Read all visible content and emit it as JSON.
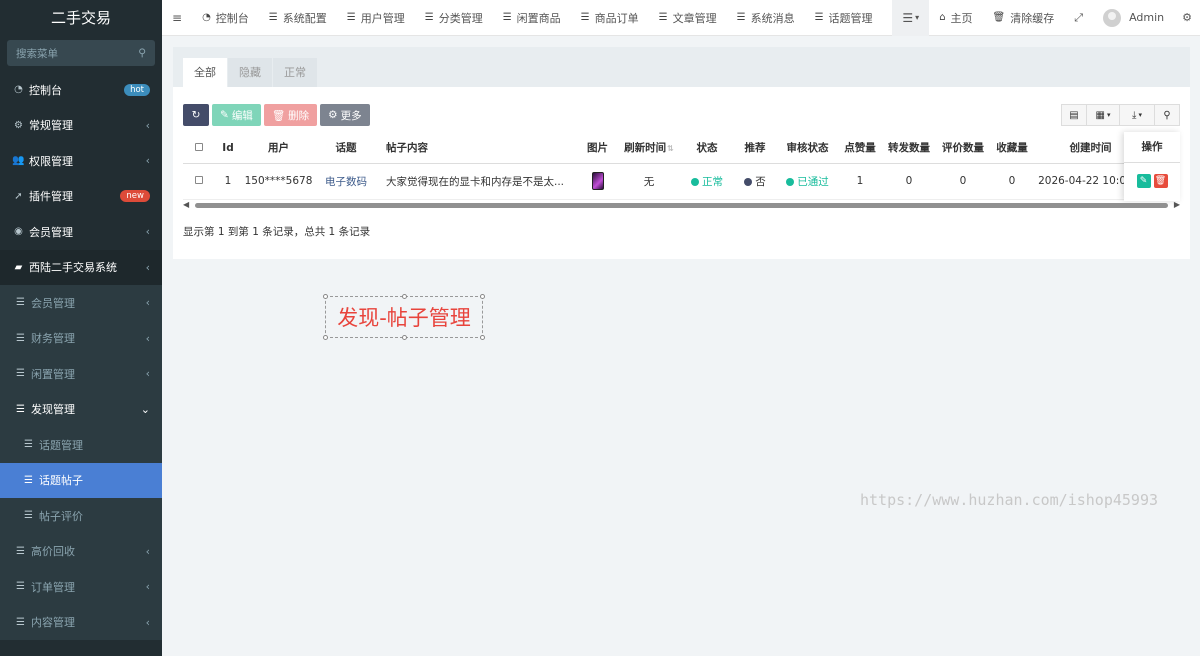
{
  "app": {
    "title": "二手交易"
  },
  "sidebar": {
    "search_placeholder": "搜索菜单",
    "items": [
      {
        "label": "控制台",
        "badge": "hot"
      },
      {
        "label": "常规管理"
      },
      {
        "label": "权限管理"
      },
      {
        "label": "插件管理",
        "badge": "new"
      },
      {
        "label": "会员管理"
      },
      {
        "label": "西陆二手交易系统"
      }
    ],
    "sub_items": [
      {
        "label": "会员管理"
      },
      {
        "label": "财务管理"
      },
      {
        "label": "闲置管理"
      },
      {
        "label": "发现管理"
      },
      {
        "label": "话题管理"
      },
      {
        "label": "话题帖子"
      },
      {
        "label": "帖子评价"
      },
      {
        "label": "高价回收"
      },
      {
        "label": "订单管理"
      },
      {
        "label": "内容管理"
      }
    ]
  },
  "topnav": {
    "items": [
      "控制台",
      "系统配置",
      "用户管理",
      "分类管理",
      "闲置商品",
      "商品订单",
      "文章管理",
      "系统消息",
      "话题管理"
    ],
    "home": "主页",
    "clear_cache": "清除缓存",
    "user": "Admin"
  },
  "tabs": [
    "全部",
    "隐藏",
    "正常"
  ],
  "toolbar": {
    "edit": "编辑",
    "delete": "删除",
    "more": "更多"
  },
  "table": {
    "headers": [
      "Id",
      "用户",
      "话题",
      "帖子内容",
      "图片",
      "刷新时间",
      "状态",
      "推荐",
      "审核状态",
      "点赞量",
      "转发数量",
      "评价数量",
      "收藏量",
      "创建时间"
    ],
    "action_header": "操作",
    "rows": [
      {
        "id": "1",
        "user": "150****5678",
        "topic": "电子数码",
        "content": "大家觉得现在的显卡和内存是不是太...",
        "refresh": "无",
        "status": "正常",
        "recommend": "否",
        "audit": "已通过",
        "likes": "1",
        "shares": "0",
        "reviews": "0",
        "favorites": "0",
        "created": "2026-04-22 10:08:4"
      }
    ]
  },
  "pagination": {
    "summary": "显示第 1 到第 1 条记录，总共 1 条记录"
  },
  "caption": "发现-帖子管理",
  "watermark": "https://www.huzhan.com/ishop45993",
  "colors": {
    "sidebar_bg": "#222d32",
    "active": "#4a7fd4",
    "success": "#18bc9c",
    "danger": "#e74c3c",
    "caption": "#e8443c"
  }
}
